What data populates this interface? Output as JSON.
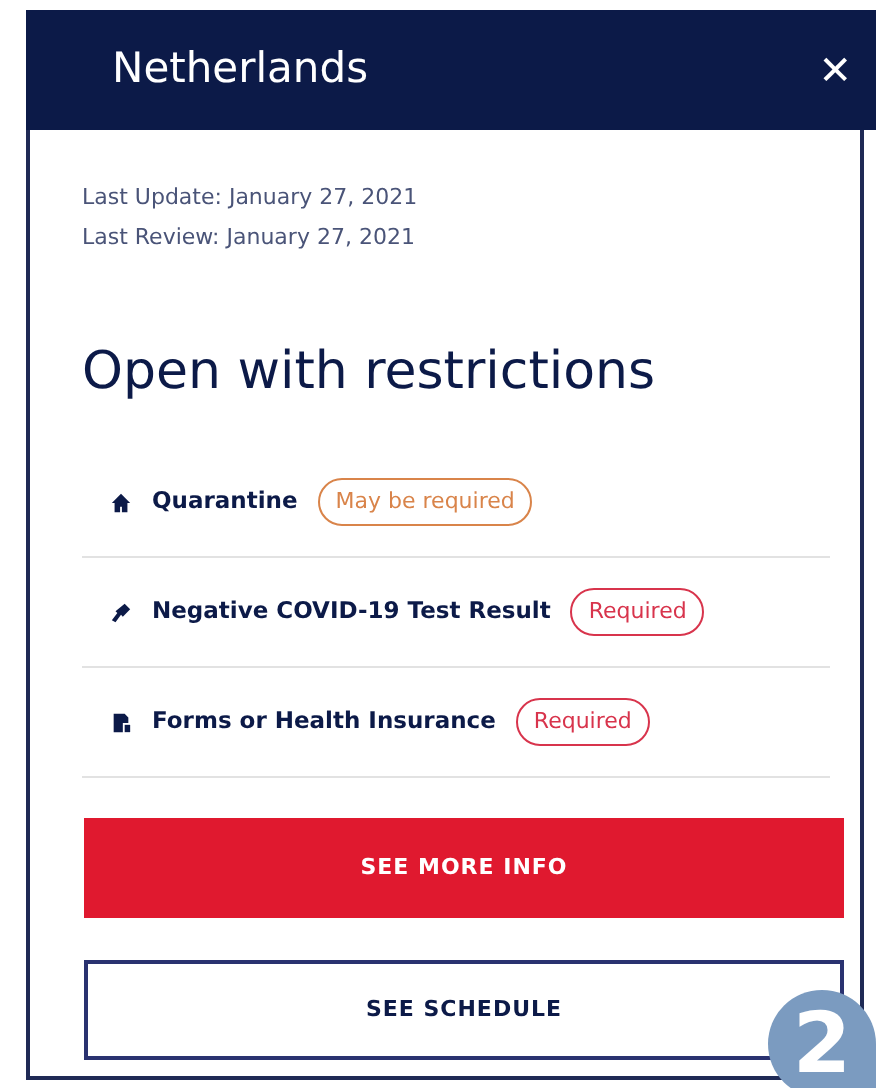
{
  "dialog": {
    "title": "Netherlands",
    "close": "✕"
  },
  "updates": [
    "Last Update: January 27, 2021",
    "Last Review: January 27, 2021"
  ],
  "status": "Open with restrictions",
  "requirements": [
    {
      "kind": "house",
      "label": "Quarantine",
      "badge": "May be required",
      "color": "#d9844a"
    },
    {
      "kind": "test",
      "label": "Negative COVID-19 Test Result",
      "badge": "Required",
      "color": "#d8344c"
    },
    {
      "kind": "form",
      "label": "Forms or Health Insurance",
      "badge": "Required",
      "color": "#d8344c"
    }
  ],
  "buttons": [
    {
      "kind": "primary",
      "label": "SEE MORE INFO"
    },
    {
      "kind": "outline",
      "label": "SEE SCHEDULE"
    }
  ],
  "step_marker": "2"
}
